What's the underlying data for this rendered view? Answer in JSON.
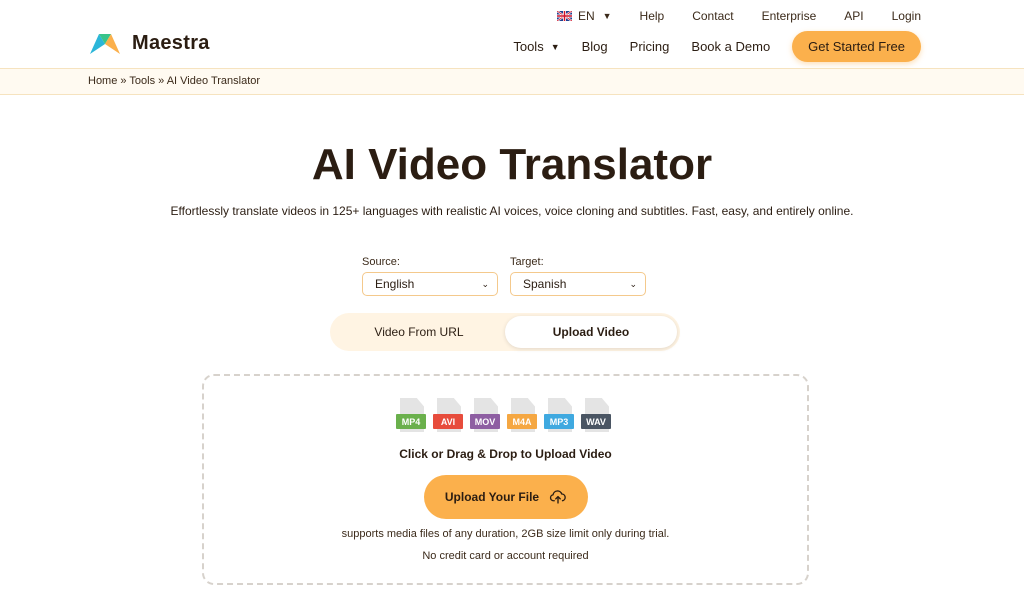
{
  "header": {
    "brand": "Maestra",
    "utility": {
      "language": "EN",
      "help": "Help",
      "contact": "Contact",
      "enterprise": "Enterprise",
      "api": "API",
      "login": "Login"
    },
    "nav": {
      "tools": "Tools",
      "blog": "Blog",
      "pricing": "Pricing",
      "book_demo": "Book a Demo",
      "cta": "Get Started Free"
    }
  },
  "breadcrumb": {
    "home": "Home",
    "tools": "Tools",
    "current": "AI Video Translator",
    "separator": "»"
  },
  "hero": {
    "title": "AI Video Translator",
    "subtitle": "Effortlessly translate videos in 125+ languages with realistic AI voices, voice cloning and subtitles. Fast, easy, and entirely online."
  },
  "languages": {
    "source_label": "Source:",
    "source_value": "English",
    "target_label": "Target:",
    "target_value": "Spanish"
  },
  "mode_toggle": {
    "url_label": "Video From URL",
    "upload_label": "Upload Video",
    "active": "upload"
  },
  "upload": {
    "formats": [
      {
        "label": "MP4",
        "color": "#6ab04c"
      },
      {
        "label": "AVI",
        "color": "#e74c3c"
      },
      {
        "label": "MOV",
        "color": "#8e5ea2"
      },
      {
        "label": "M4A",
        "color": "#f5a742"
      },
      {
        "label": "MP3",
        "color": "#3fa9e0"
      },
      {
        "label": "WAV",
        "color": "#4a5563"
      }
    ],
    "title": "Click or Drag & Drop to Upload Video",
    "button": "Upload Your File",
    "note1": "supports media files of any duration, 2GB size limit only during trial.",
    "note2": "No credit card or account required"
  },
  "colors": {
    "accent": "#fbb04c",
    "text": "#2b1d12",
    "crumb_bg": "#fffaf1"
  }
}
